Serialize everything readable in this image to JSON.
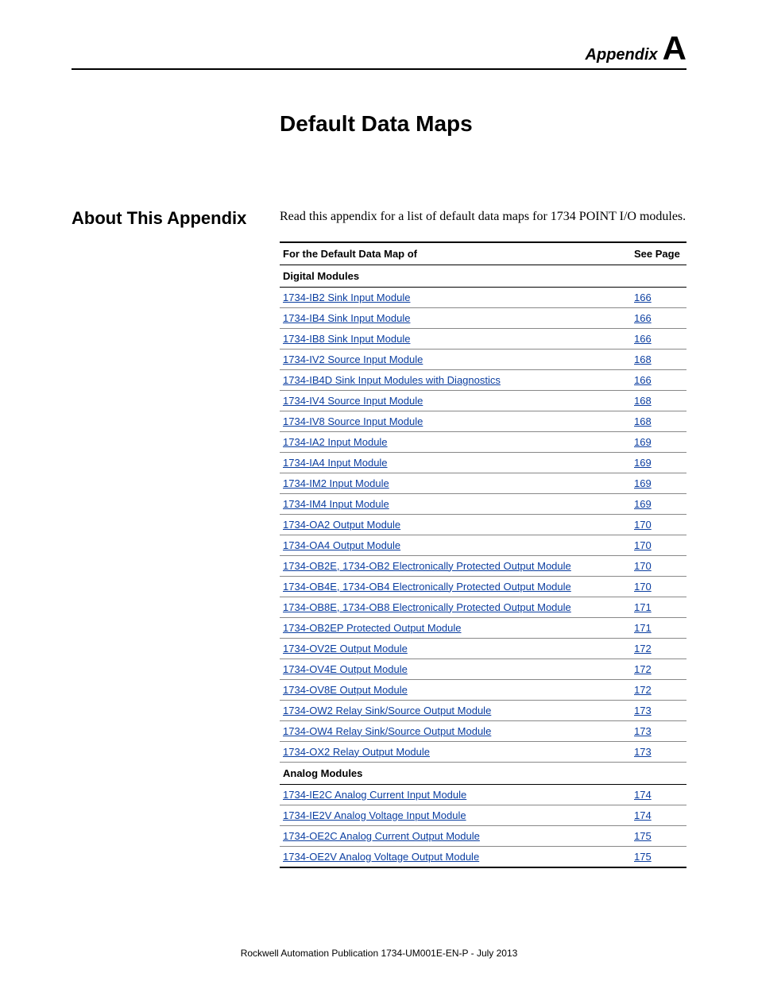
{
  "header": {
    "appendix_word": "Appendix",
    "appendix_letter": "A"
  },
  "title": "Default Data Maps",
  "section": {
    "heading": "About This Appendix",
    "intro": "Read this appendix for a list of default data maps for 1734 POINT I/O modules."
  },
  "table": {
    "col_module": "For the Default Data Map of",
    "col_page": "See Page",
    "group_digital": "Digital Modules",
    "group_analog": "Analog Modules",
    "digital": [
      {
        "name": "1734-IB2 Sink Input Module",
        "page": "166"
      },
      {
        "name": "1734-IB4 Sink Input Module",
        "page": "166"
      },
      {
        "name": "1734-IB8 Sink Input Module",
        "page": "166"
      },
      {
        "name": "1734-IV2 Source Input Module",
        "page": "168"
      },
      {
        "name": "1734-IB4D Sink Input Modules with Diagnostics",
        "page": "166"
      },
      {
        "name": "1734-IV4 Source Input Module",
        "page": "168"
      },
      {
        "name": "1734-IV8 Source Input Module",
        "page": "168"
      },
      {
        "name": "1734-IA2 Input Module",
        "page": "169"
      },
      {
        "name": "1734-IA4 Input Module",
        "page": "169"
      },
      {
        "name": "1734-IM2 Input Module",
        "page": "169"
      },
      {
        "name": "1734-IM4 Input Module",
        "page": "169"
      },
      {
        "name": "1734-OA2 Output Module",
        "page": "170"
      },
      {
        "name": "1734-OA4 Output Module",
        "page": "170"
      },
      {
        "name": "1734-OB2E, 1734-OB2 Electronically Protected Output Module",
        "page": "170"
      },
      {
        "name": "1734-OB4E, 1734-OB4 Electronically Protected Output Module",
        "page": "170"
      },
      {
        "name": "1734-OB8E, 1734-OB8 Electronically Protected Output Module",
        "page": "171"
      },
      {
        "name": "1734-OB2EP Protected Output Module",
        "page": "171"
      },
      {
        "name": "1734-OV2E Output Module",
        "page": "172"
      },
      {
        "name": "1734-OV4E Output Module",
        "page": "172"
      },
      {
        "name": "1734-OV8E Output Module",
        "page": "172"
      },
      {
        "name": "1734-OW2 Relay Sink/Source Output Module",
        "page": "173"
      },
      {
        "name": "1734-OW4 Relay Sink/Source Output Module",
        "page": "173"
      },
      {
        "name": "1734-OX2 Relay Output Module",
        "page": "173"
      }
    ],
    "analog": [
      {
        "name": "1734-IE2C Analog Current Input Module",
        "page": "174"
      },
      {
        "name": "1734-IE2V Analog Voltage Input Module",
        "page": "174"
      },
      {
        "name": "1734-OE2C Analog Current Output Module",
        "page": "175"
      },
      {
        "name": "1734-OE2V Analog Voltage Output Module",
        "page": "175"
      }
    ]
  },
  "footer": "Rockwell Automation Publication 1734-UM001E-EN-P - July 2013"
}
